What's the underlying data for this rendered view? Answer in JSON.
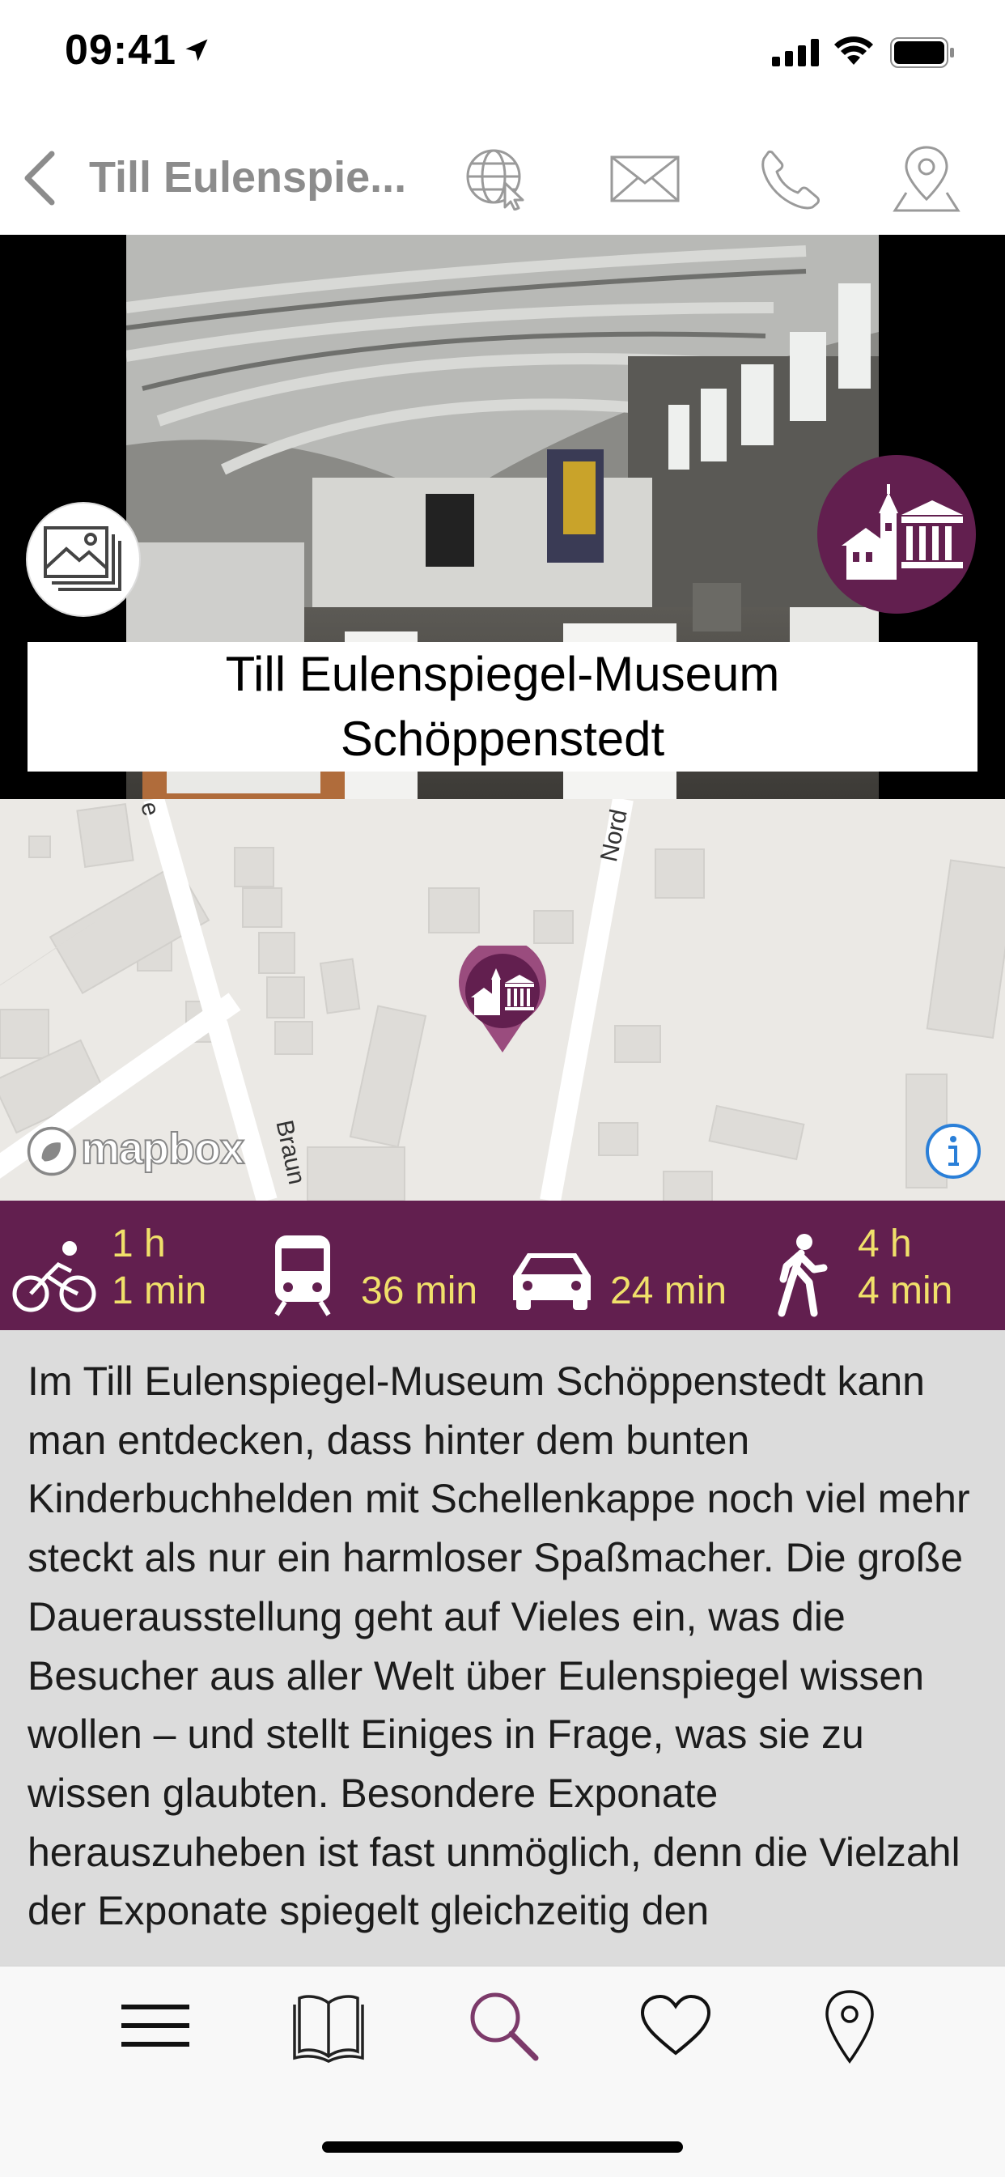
{
  "status_bar": {
    "time": "09:41"
  },
  "nav": {
    "title": "Till Eulenspie..."
  },
  "poi": {
    "title_line1": "Till Eulenspiegel-Museum",
    "title_line2": "Schöppenstedt"
  },
  "map": {
    "attribution": "mapbox",
    "street_labels": [
      "e",
      "Nord",
      "Braun"
    ]
  },
  "travel": [
    {
      "mode": "bike-icon",
      "line1": "1 h",
      "line2": "1 min"
    },
    {
      "mode": "train-icon",
      "line1": "",
      "line2": "36 min"
    },
    {
      "mode": "car-icon",
      "line1": "",
      "line2": "24 min"
    },
    {
      "mode": "walk-icon",
      "line1": "4 h",
      "line2": "4 min"
    }
  ],
  "description": "Im Till Eulenspiegel-Museum Schöppenstedt kann man entdecken, dass hinter dem bunten Kinderbuchhelden mit Schellenkappe noch viel mehr steckt als nur ein harmloser Spaßmacher. Die große Dauerausstellung geht auf Vieles ein, was die Besucher aus aller Welt über Eulenspiegel wissen wollen – und stellt Einiges in Frage, was sie zu wissen glaubten. Besondere Exponate herauszuheben ist fast unmöglich, denn die Vielzahl der Exponate spiegelt gleichzeitig den",
  "tab_bar": [
    {
      "name": "menu-icon"
    },
    {
      "name": "book-icon"
    },
    {
      "name": "search-icon",
      "active": true
    },
    {
      "name": "heart-icon"
    },
    {
      "name": "location-pin-icon"
    }
  ],
  "colors": {
    "accent": "#621f4f",
    "travel_text": "#f0e06a",
    "nav_gray": "#8c8c8c",
    "description_bg": "#dcdcdc"
  }
}
